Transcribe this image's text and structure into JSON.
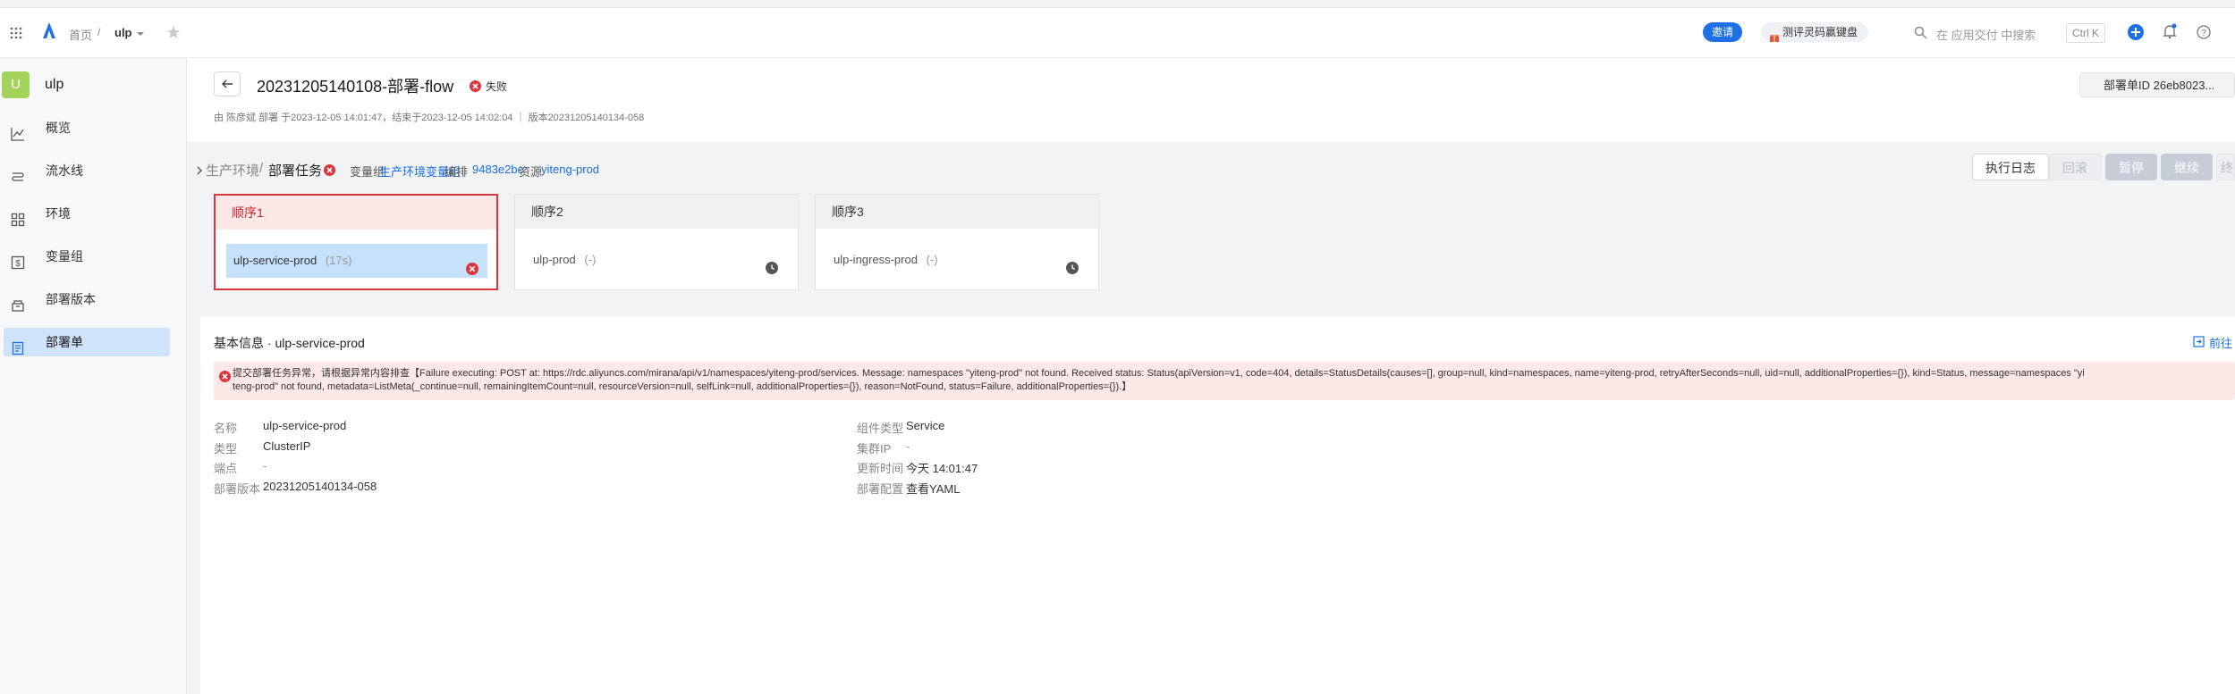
{
  "header": {
    "breadcrumb_home": "首页",
    "project": "ulp",
    "invite_button": "邀请",
    "promo_button": "测评灵码赢键盘",
    "search_placeholder": "在 应用交付 中搜索",
    "shortcut": "Ctrl K"
  },
  "sidebar": {
    "project_badge": "U",
    "project_name": "ulp",
    "items": [
      {
        "label": "概览",
        "icon": "chart-icon"
      },
      {
        "label": "流水线",
        "icon": "pipeline-icon"
      },
      {
        "label": "环境",
        "icon": "grid-icon"
      },
      {
        "label": "变量组",
        "icon": "variable-icon"
      },
      {
        "label": "部署版本",
        "icon": "package-icon"
      },
      {
        "label": "部署单",
        "icon": "document-icon",
        "active": true
      }
    ]
  },
  "deployment": {
    "title": "20231205140108-部署-flow",
    "status": "失败",
    "meta": "由 陈彦斌 部署 于2023-12-05 14:01:47，结束于2023-12-05 14:02:04 ｜ 版本20231205140134-058",
    "deploy_id": "部署单ID 26eb8023..."
  },
  "task_bar": {
    "env": "生产环境",
    "task": "部署任务",
    "var_group_label": "变量组",
    "var_group_value": "生产环境变量组",
    "orchestration_label": "编排",
    "orchestration_value": "9483e2be",
    "resource_label": "资源",
    "resource_value": "yiteng-prod",
    "log_button": "执行日志",
    "rollback_button": "回滚",
    "pause_button": "暂停",
    "continue_button": "继续",
    "terminate_button": "终"
  },
  "stages": [
    {
      "title": "顺序1",
      "job": "ulp-service-prod",
      "duration": "(17s)",
      "state": "failed"
    },
    {
      "title": "顺序2",
      "job": "ulp-prod",
      "duration": "(-)",
      "state": "pending"
    },
    {
      "title": "顺序3",
      "job": "ulp-ingress-prod",
      "duration": "(-)",
      "state": "pending"
    }
  ],
  "details": {
    "section_title": "基本信息 · ulp-service-prod",
    "goto_link": "前往",
    "error_line1": "提交部署任务异常，请根据异常内容排查【Failure executing: POST at: https://rdc.aliyuncs.com/mirana/api/v1/namespaces/yiteng-prod/services. Message: namespaces \"yiteng-prod\" not found. Received status: Status(apiVersion=v1, code=404, details=StatusDetails(causes=[], group=null, kind=namespaces, name=yiteng-prod, retryAfterSeconds=null, uid=null, additionalProperties={}), kind=Status, message=namespaces \"yi",
    "error_line2": "teng-prod\" not found, metadata=ListMeta(_continue=null, remainingItemCount=null, resourceVersion=null, selfLink=null, additionalProperties={}), reason=NotFound, status=Failure, additionalProperties={}).】",
    "left": [
      {
        "label": "名称",
        "value": "ulp-service-prod"
      },
      {
        "label": "类型",
        "value": "ClusterIP"
      },
      {
        "label": "端点",
        "value": "-"
      },
      {
        "label": "部署版本",
        "value": "20231205140134-058"
      }
    ],
    "right": [
      {
        "label": "组件类型",
        "value": "Service"
      },
      {
        "label": "集群IP",
        "value": "-"
      },
      {
        "label": "更新时间",
        "value": "今天 14:01:47"
      },
      {
        "label": "部署配置",
        "value": "查看YAML"
      }
    ]
  },
  "colors": {
    "accent": "#1b6fe0",
    "danger": "#d9363e",
    "active_nav": "#cfe4fb",
    "project_badge": "#a4d35c"
  }
}
